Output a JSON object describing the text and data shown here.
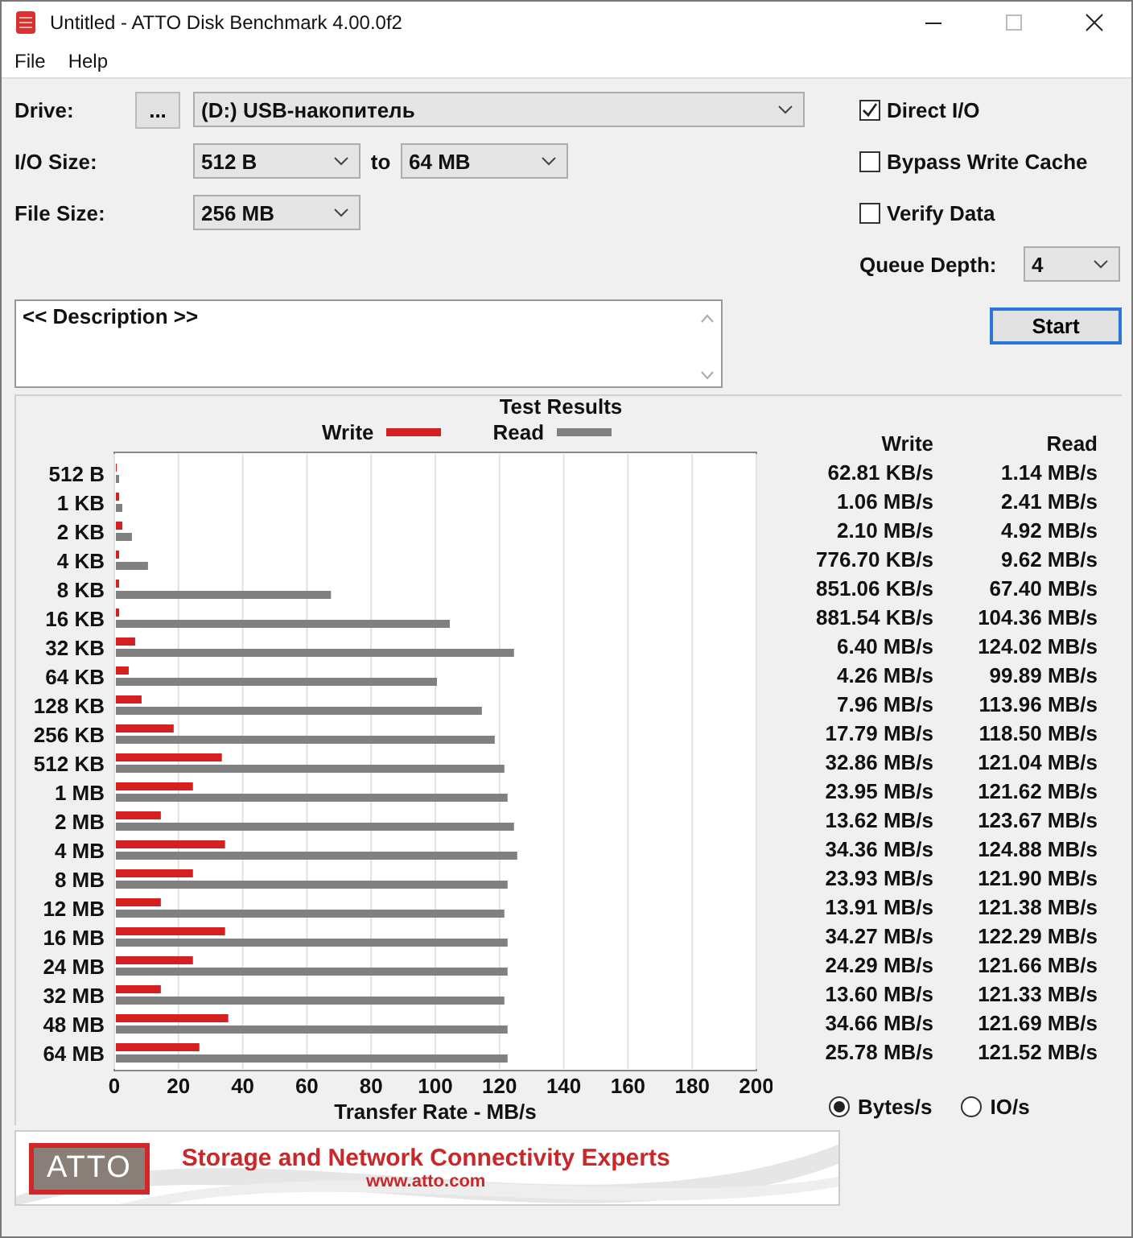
{
  "window": {
    "title": "Untitled - ATTO Disk Benchmark 4.00.0f2"
  },
  "menu": [
    "File",
    "Help"
  ],
  "drive": {
    "label": "Drive:",
    "browse": "...",
    "value": "(D:) USB-накопитель"
  },
  "io_size": {
    "label": "I/O Size:",
    "from": "512 B",
    "to_label": "to",
    "to": "64 MB"
  },
  "file_size": {
    "label": "File Size:",
    "value": "256 MB"
  },
  "options": [
    {
      "label": "Direct I/O",
      "checked": true
    },
    {
      "label": "Bypass Write Cache",
      "checked": false
    },
    {
      "label": "Verify Data",
      "checked": false
    }
  ],
  "queue_depth": {
    "label": "Queue Depth:",
    "value": "4"
  },
  "start_button": "Start",
  "description": "<< Description >>",
  "results": {
    "title": "Test Results",
    "chart_data": {
      "type": "bar",
      "orientation": "horizontal",
      "grid": true,
      "xlabel": "Transfer Rate - MB/s",
      "xlim": [
        0,
        200
      ],
      "xticks": [
        0,
        20,
        40,
        60,
        80,
        100,
        120,
        140,
        160,
        180,
        200
      ],
      "categories": [
        "512 B",
        "1 KB",
        "2 KB",
        "4 KB",
        "8 KB",
        "16 KB",
        "32 KB",
        "64 KB",
        "128 KB",
        "256 KB",
        "512 KB",
        "1 MB",
        "2 MB",
        "4 MB",
        "8 MB",
        "12 MB",
        "16 MB",
        "24 MB",
        "32 MB",
        "48 MB",
        "64 MB"
      ],
      "series": [
        {
          "name": "Write",
          "color": "#d42020",
          "values": [
            0,
            1,
            2,
            1,
            1,
            1,
            6,
            4,
            8,
            18,
            33,
            24,
            14,
            34,
            24,
            14,
            34,
            24,
            14,
            35,
            26
          ]
        },
        {
          "name": "Read",
          "color": "#808080",
          "values": [
            1,
            2,
            5,
            10,
            67,
            104,
            124,
            100,
            114,
            118,
            121,
            122,
            124,
            125,
            122,
            121,
            122,
            122,
            121,
            122,
            122
          ]
        }
      ]
    },
    "columns": [
      "Write",
      "Read"
    ],
    "rows": [
      {
        "write": "62.81 KB/s",
        "read": "1.14 MB/s"
      },
      {
        "write": "1.06 MB/s",
        "read": "2.41 MB/s"
      },
      {
        "write": "2.10 MB/s",
        "read": "4.92 MB/s"
      },
      {
        "write": "776.70 KB/s",
        "read": "9.62 MB/s"
      },
      {
        "write": "851.06 KB/s",
        "read": "67.40 MB/s"
      },
      {
        "write": "881.54 KB/s",
        "read": "104.36 MB/s"
      },
      {
        "write": "6.40 MB/s",
        "read": "124.02 MB/s"
      },
      {
        "write": "4.26 MB/s",
        "read": "99.89 MB/s"
      },
      {
        "write": "7.96 MB/s",
        "read": "113.96 MB/s"
      },
      {
        "write": "17.79 MB/s",
        "read": "118.50 MB/s"
      },
      {
        "write": "32.86 MB/s",
        "read": "121.04 MB/s"
      },
      {
        "write": "23.95 MB/s",
        "read": "121.62 MB/s"
      },
      {
        "write": "13.62 MB/s",
        "read": "123.67 MB/s"
      },
      {
        "write": "34.36 MB/s",
        "read": "124.88 MB/s"
      },
      {
        "write": "23.93 MB/s",
        "read": "121.90 MB/s"
      },
      {
        "write": "13.91 MB/s",
        "read": "121.38 MB/s"
      },
      {
        "write": "34.27 MB/s",
        "read": "122.29 MB/s"
      },
      {
        "write": "24.29 MB/s",
        "read": "121.66 MB/s"
      },
      {
        "write": "13.60 MB/s",
        "read": "121.33 MB/s"
      },
      {
        "write": "34.66 MB/s",
        "read": "121.69 MB/s"
      },
      {
        "write": "25.78 MB/s",
        "read": "121.52 MB/s"
      }
    ]
  },
  "units": [
    {
      "label": "Bytes/s",
      "selected": true
    },
    {
      "label": "IO/s",
      "selected": false
    }
  ],
  "banner": {
    "logo": "ATTO",
    "tagline": "Storage and Network Connectivity Experts",
    "url": "www.atto.com"
  }
}
